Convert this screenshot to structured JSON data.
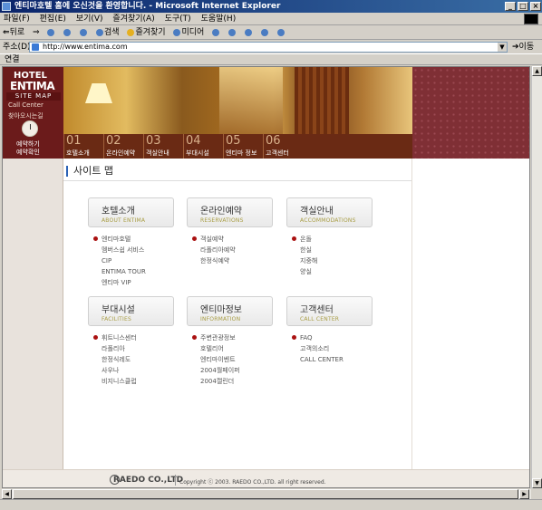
{
  "window": {
    "title": "엔티마호텔 홈에 오신것을 환영합니다. - Microsoft Internet Explorer"
  },
  "menu": [
    "파일(F)",
    "편집(E)",
    "보기(V)",
    "즐겨찾기(A)",
    "도구(T)",
    "도움말(H)"
  ],
  "toolbar": {
    "back": "뒤로",
    "search": "검색",
    "favorites": "즐겨찾기",
    "media": "미디어"
  },
  "address": {
    "label": "주소(D)",
    "url": "http://www.entima.com",
    "go": "이동"
  },
  "links_label": "연결",
  "brand": {
    "hotel": "HOTEL",
    "entima": "ENTIMA",
    "sitemap_tag": "SITE MAP",
    "call_center": "Call Center",
    "directions": "찾아오시는길",
    "reserve": "예약하기",
    "confirm": "예약확인"
  },
  "nav_tabs": [
    {
      "num": "01",
      "label": "호텔소개"
    },
    {
      "num": "02",
      "label": "온라인예약"
    },
    {
      "num": "03",
      "label": "객실안내"
    },
    {
      "num": "04",
      "label": "부대시설"
    },
    {
      "num": "05",
      "label": "엔티마 정보"
    },
    {
      "num": "06",
      "label": "고객센터"
    }
  ],
  "page_title": "사이트 맵",
  "categories": [
    {
      "ko": "호텔소개",
      "en": "ABOUT ENTIMA",
      "items": [
        "엔티마호텔",
        "멤버스쉽 서비스",
        "CIP",
        "ENTIMA TOUR",
        "엔티마 VIP"
      ]
    },
    {
      "ko": "온라인예약",
      "en": "RESERVATIONS",
      "items": [
        "객실예약",
        "라폴리아예약",
        "한정식예약"
      ]
    },
    {
      "ko": "객실안내",
      "en": "ACCOMMODATIONS",
      "items": [
        "온돌",
        "한실",
        "지중해",
        "양실"
      ]
    },
    {
      "ko": "부대시설",
      "en": "FACILITIES",
      "items": [
        "휘트니스센터",
        "라폴리아",
        "한정식레도",
        "사우나",
        "비지니스클럽"
      ]
    },
    {
      "ko": "엔티마정보",
      "en": "INFORMATION",
      "items": [
        "주변관광정보",
        "호텔리어",
        "엔티마이벤트",
        "2004월페이퍼",
        "2004캘린더"
      ]
    },
    {
      "ko": "고객센터",
      "en": "CALL CENTER",
      "items": [
        "FAQ",
        "고객의소리",
        "CALL CENTER"
      ]
    }
  ],
  "footer": {
    "company": "RAEDO CO.,LTD",
    "copyright": "Copyright ⓒ 2003. RAEDO CO.,LTD. all right reserved."
  }
}
